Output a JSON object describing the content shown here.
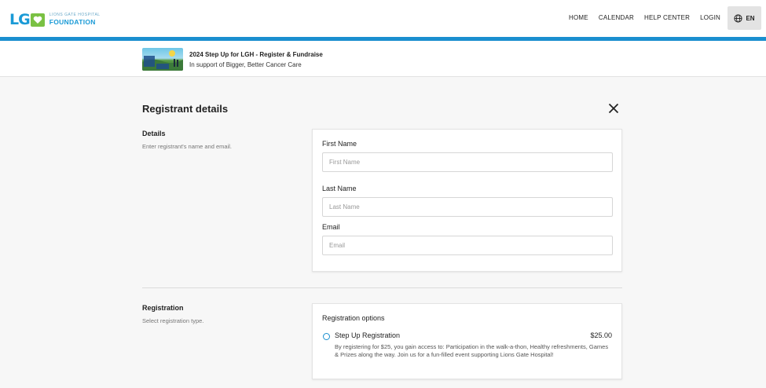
{
  "brand": {
    "logo_letters": "LG",
    "logo_sub": "LIONS GATE HOSPITAL",
    "logo_main": "FOUNDATION",
    "primary_color": "#1a8fcf",
    "heart_color": "#7ac143"
  },
  "nav": {
    "items": [
      "HOME",
      "CALENDAR",
      "HELP CENTER",
      "LOGIN"
    ],
    "language": "EN",
    "language_icon": "globe-icon"
  },
  "event": {
    "title": "2024 Step Up for LGH - Register & Fundraise",
    "subtitle": "In support of Bigger, Better Cancer Care"
  },
  "page": {
    "title": "Registrant details",
    "close_icon": "close-icon"
  },
  "details": {
    "title": "Details",
    "description": "Enter registrant's name and email.",
    "first_name": {
      "label": "First Name",
      "placeholder": "First Name",
      "value": ""
    },
    "last_name": {
      "label": "Last Name",
      "placeholder": "Last Name",
      "value": ""
    },
    "email": {
      "label": "Email",
      "placeholder": "Email",
      "value": ""
    }
  },
  "registration": {
    "title": "Registration",
    "description": "Select registration type.",
    "options_heading": "Registration options",
    "options": [
      {
        "name": "Step Up Registration",
        "price": "$25.00",
        "description": "By registering for $25, you gain access to: Participation in the walk-a-thon, Healthy refreshments, Games & Prizes along the way. Join us for a fun-filled event supporting Lions Gate Hospital!",
        "selected": false
      }
    ]
  }
}
